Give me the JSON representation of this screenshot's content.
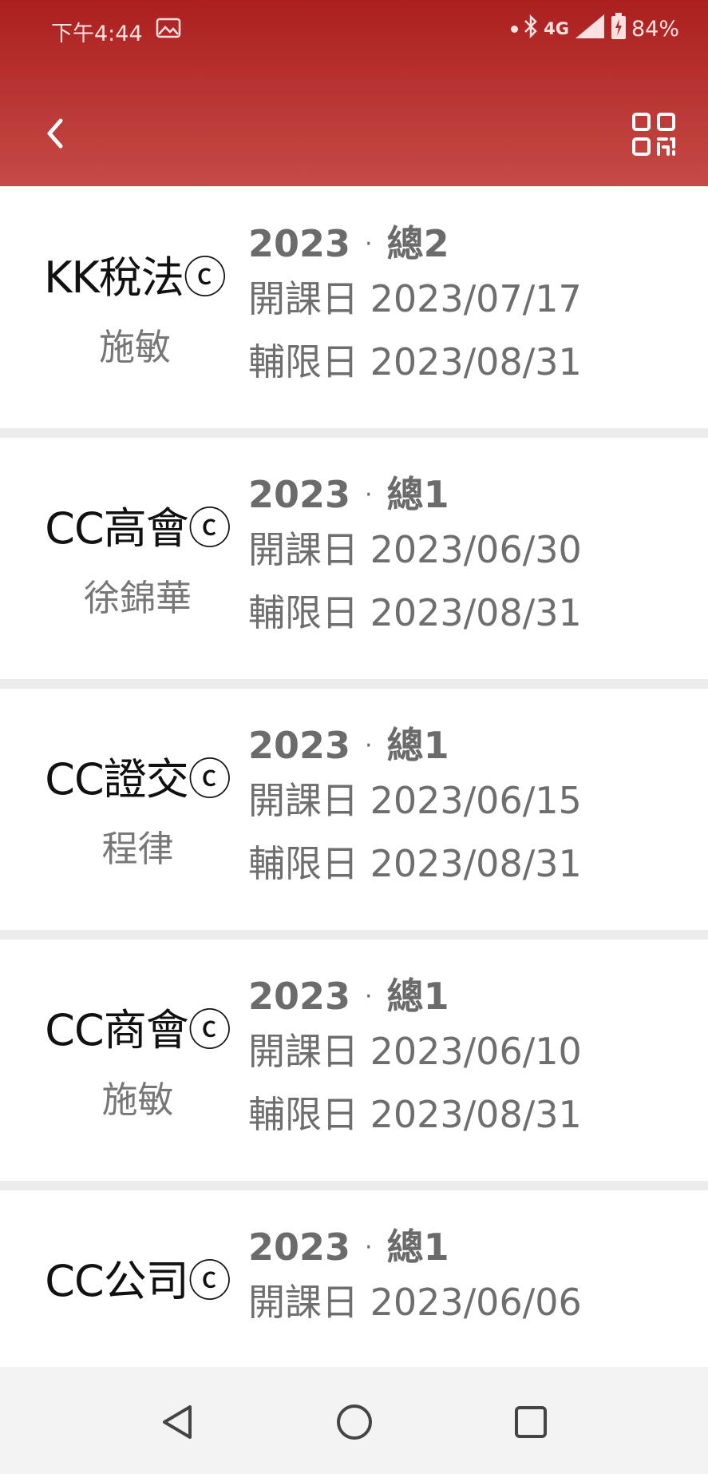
{
  "status_bar": {
    "time": "下午4:44",
    "network": "4G",
    "battery": "84%"
  },
  "header": {
    "back_icon": "chevron-left-icon",
    "qr_icon": "qr-code-icon",
    "color_top": "#ab1f1f",
    "color_bottom": "#c64a46"
  },
  "courses": [
    {
      "name": "KK稅法ⓒ",
      "teacher": "施敏",
      "year": "2023",
      "total": "總2",
      "start": "開課日 2023/07/17",
      "deadline": "輔限日 2023/08/31"
    },
    {
      "name": "CC高會ⓒ",
      "teacher": "徐錦華",
      "year": "2023",
      "total": "總1",
      "start": "開課日 2023/06/30",
      "deadline": "輔限日 2023/08/31"
    },
    {
      "name": "CC證交ⓒ",
      "teacher": "程律",
      "year": "2023",
      "total": "總1",
      "start": "開課日 2023/06/15",
      "deadline": "輔限日 2023/08/31"
    },
    {
      "name": "CC商會ⓒ",
      "teacher": "施敏",
      "year": "2023",
      "total": "總1",
      "start": "開課日 2023/06/10",
      "deadline": "輔限日 2023/08/31"
    },
    {
      "name": "CC公司ⓒ",
      "teacher": "",
      "year": "2023",
      "total": "總1",
      "start": "開課日 2023/06/06",
      "deadline": ""
    }
  ],
  "nav_bar": {
    "back_icon": "triangle-back-icon",
    "home_icon": "circle-home-icon",
    "recents_icon": "square-recents-icon"
  }
}
